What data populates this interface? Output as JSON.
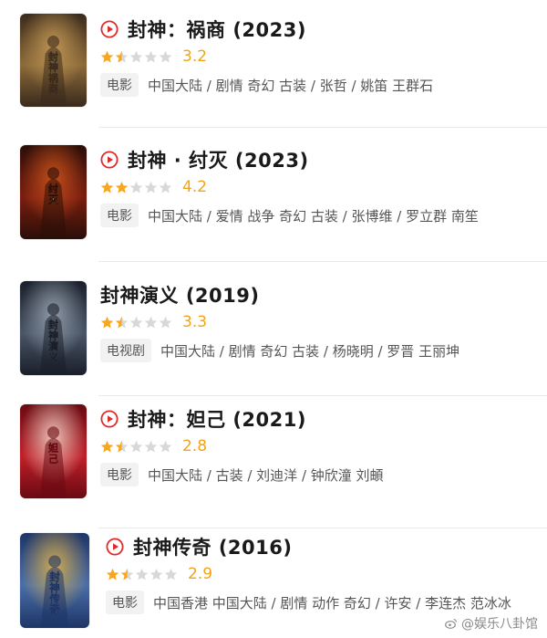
{
  "items": [
    {
      "title": "封神：祸商",
      "year": "(2023)",
      "has_play_icon": true,
      "rating_stars": 1.5,
      "score": "3.2",
      "category": "电影",
      "meta": "中国大陆 / 剧情 奇幻 古装 / 张哲 / 姚笛 王群石",
      "poster_text": "封神 祸商",
      "poster_colors": [
        "#3a2a1c",
        "#8c6a3a",
        "#c79c56"
      ]
    },
    {
      "title": "封神 · 纣灭",
      "year": "(2023)",
      "has_play_icon": true,
      "rating_stars": 2,
      "score": "4.2",
      "category": "电影",
      "meta": "中国大陆 / 爱情 战争 奇幻 古装 / 张博维 / 罗立群 南笙",
      "poster_text": "纣灭",
      "poster_colors": [
        "#2a0e08",
        "#7a1e10",
        "#d0541c"
      ]
    },
    {
      "title": "封神演义",
      "year": "(2019)",
      "has_play_icon": false,
      "rating_stars": 1.5,
      "score": "3.3",
      "category": "电视剧",
      "meta": "中国大陆 / 剧情 奇幻 古装 / 杨晓明 / 罗晋 王丽坤",
      "poster_text": "封神 演义",
      "poster_colors": [
        "#1a1f2a",
        "#4a5566",
        "#9aa6b3"
      ]
    },
    {
      "title": "封神：妲己",
      "year": "(2021)",
      "has_play_icon": true,
      "rating_stars": 1.5,
      "score": "2.8",
      "category": "电影",
      "meta": "中国大陆 / 古装 / 刘迪洋 / 钟欣潼 刘頔",
      "poster_text": "妲己",
      "poster_colors": [
        "#6a0a12",
        "#c0202a",
        "#f4d6c8"
      ]
    },
    {
      "title": "封神传奇",
      "year": "(2016)",
      "has_play_icon": true,
      "rating_stars": 1.5,
      "score": "2.9",
      "category": "电影",
      "meta": "中国香港 中国大陆 / 剧情 动作 奇幻 / 许安 / 李连杰 范冰冰",
      "poster_text": "封神传奇",
      "poster_colors": [
        "#1e3566",
        "#4a6ea8",
        "#e0b24a"
      ]
    }
  ],
  "watermark": "@娱乐八卦馆",
  "colors": {
    "play_red": "#e02a2a",
    "star_gold": "#f5a623",
    "star_gray": "#d8d8d8",
    "score": "#f0a418"
  },
  "icons": {
    "play": "play-circle-icon",
    "star": "star-icon",
    "watermark": "weibo-icon"
  }
}
